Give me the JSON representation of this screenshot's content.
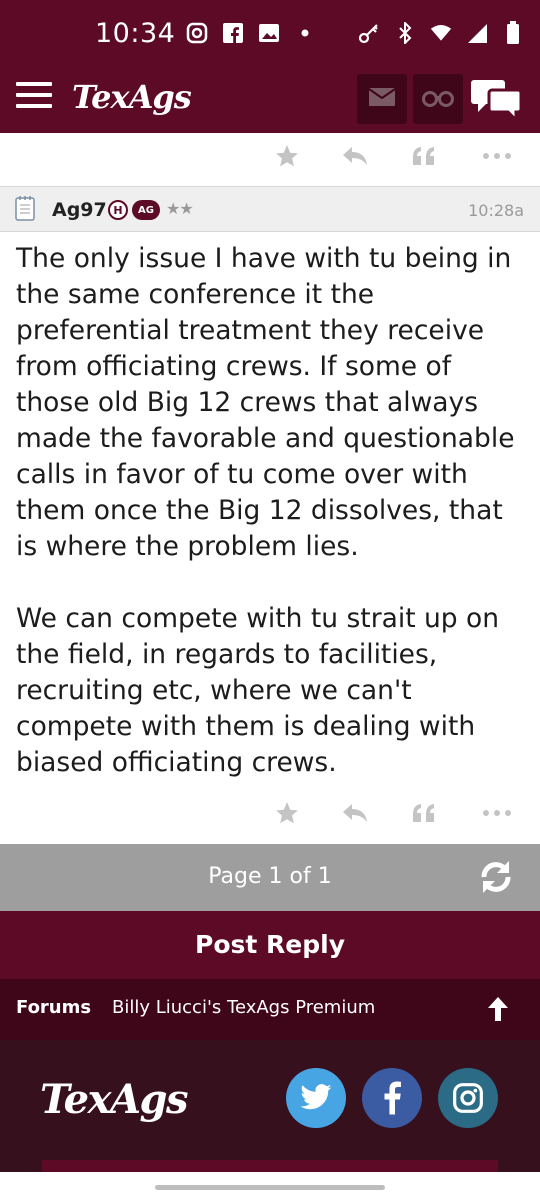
{
  "status_bar": {
    "time": "10:34",
    "left_icons": [
      "instagram-notif-icon",
      "facebook-notif-icon",
      "gallery-notif-icon",
      "dot-icon"
    ],
    "right_icons": [
      "key-icon",
      "bluetooth-icon",
      "wifi-icon",
      "signal-icon",
      "battery-icon"
    ]
  },
  "app_bar": {
    "logo": "TexAgs",
    "icons": [
      "menu-icon",
      "mail-icon",
      "binoculars-icon",
      "chat-icon"
    ]
  },
  "post": {
    "username": "Ag97",
    "badge_h": "H",
    "badge_ag": "AG",
    "stars": "★★",
    "time": "10:28a",
    "paragraphs": [
      "The only issue I have with tu being in the same conference it the preferential treatment they receive from officiating crews. If some of those old Big 12 crews that always made the favorable and questionable calls in favor of tu come over with them once the Big 12 dissolves, that is where the problem lies.",
      "We can compete with tu strait up on the field, in regards to facilities, recruiting etc, where we can't compete with them is dealing with biased officiating crews."
    ],
    "action_icons": [
      "star-icon",
      "reply-icon",
      "quote-icon",
      "more-icon"
    ]
  },
  "pager": {
    "text": "Page 1 of 1"
  },
  "reply_button": "Post Reply",
  "breadcrumb": {
    "forums": "Forums",
    "board": "Billy Liucci's TexAgs Premium"
  },
  "footer": {
    "logo": "TexAgs",
    "social": [
      "twitter-icon",
      "facebook-icon",
      "instagram-icon"
    ]
  },
  "colors": {
    "maroon": "#5d0a27",
    "dark_maroon": "#3f0519",
    "footer_bg": "#37101d",
    "pager_gray": "#9e9e9e",
    "twitter": "#48a5e3",
    "facebook": "#3b5ba3",
    "instagram": "#2b6b85"
  }
}
